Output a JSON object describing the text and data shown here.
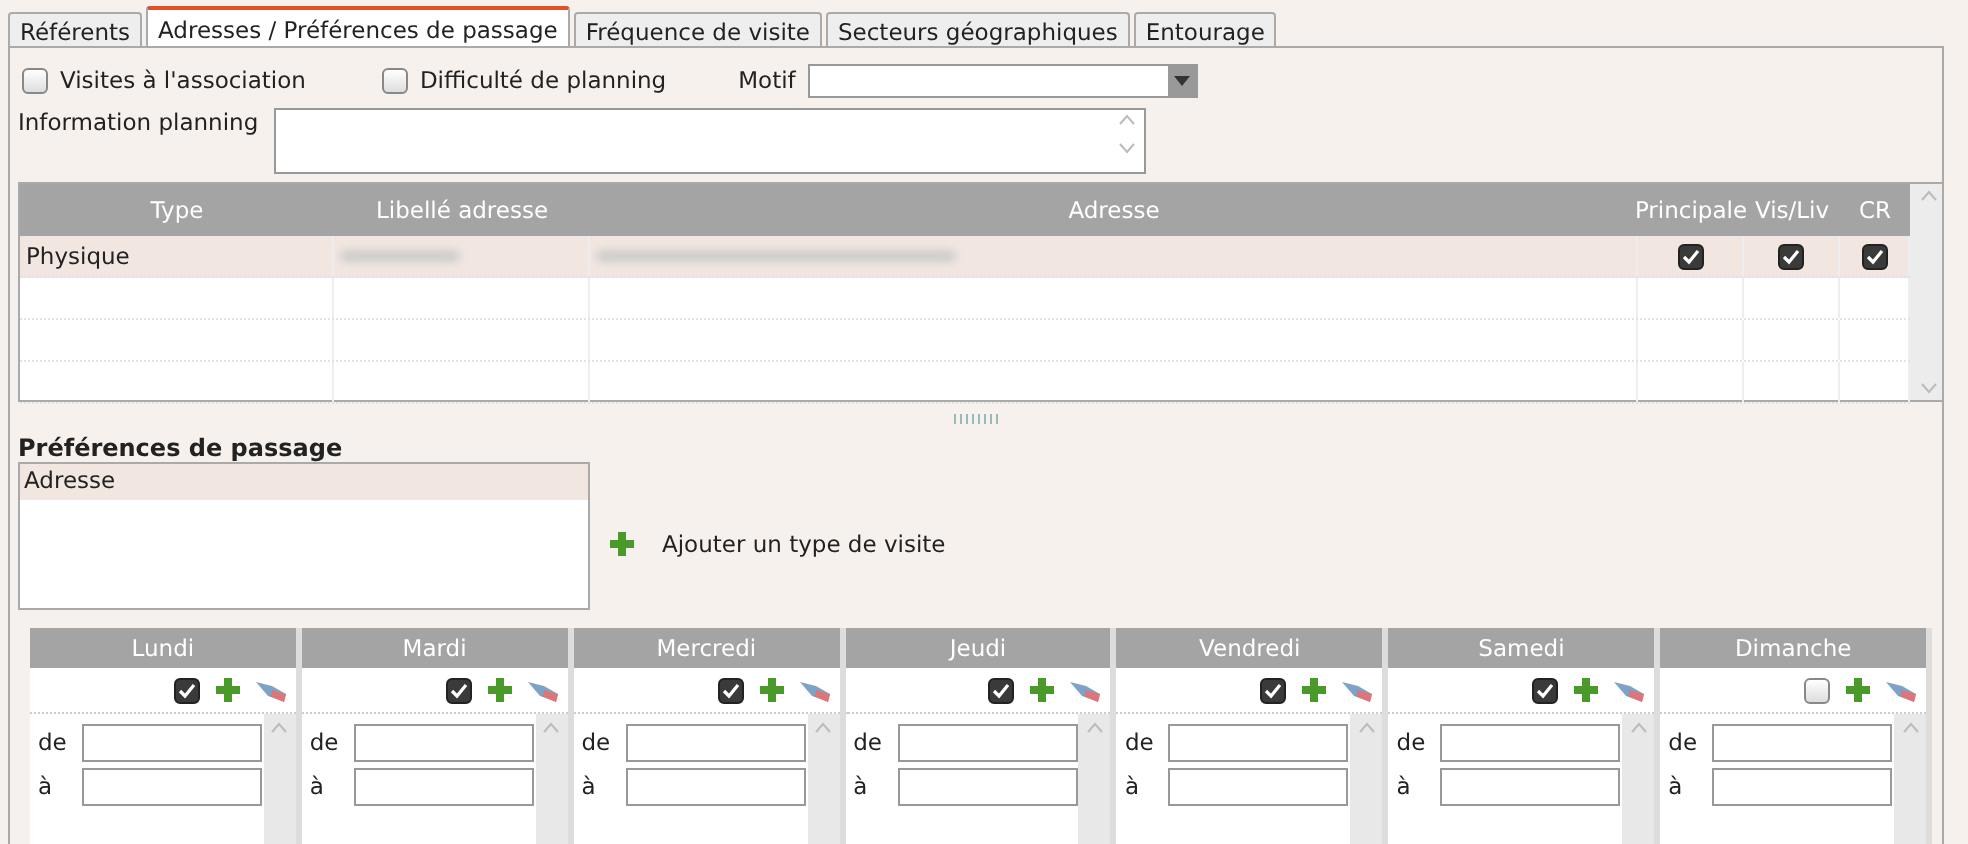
{
  "tabs": [
    {
      "label": "Référents",
      "selected": false
    },
    {
      "label": "Adresses / Préférences de passage",
      "selected": true
    },
    {
      "label": "Fréquence de visite",
      "selected": false
    },
    {
      "label": "Secteurs géographiques",
      "selected": false
    },
    {
      "label": "Entourage",
      "selected": false
    }
  ],
  "options": [
    {
      "label": "Visites à l'association",
      "checked": false
    },
    {
      "label": "Difficulté de planning",
      "checked": false
    }
  ],
  "motif": {
    "label": "Motif"
  },
  "information_planning": {
    "label": "Information planning"
  },
  "addresses": {
    "columns": [
      "Type",
      "Libellé adresse",
      "Adresse",
      "Principale",
      "Vis/Liv",
      "CR"
    ],
    "rows": [
      {
        "type": "Physique",
        "libelle_redacted": true,
        "adresse_redacted": true,
        "principale": true,
        "vis_liv": true,
        "cr": true,
        "selected": true
      }
    ]
  },
  "preferences": {
    "title": "Préférences de passage",
    "items": [
      {
        "label": "Adresse",
        "selected": true
      }
    ],
    "add_label": "Ajouter un type de visite"
  },
  "days": [
    {
      "name": "Lundi",
      "checked": true,
      "from_label": "de",
      "to_label": "à"
    },
    {
      "name": "Mardi",
      "checked": true,
      "from_label": "de",
      "to_label": "à"
    },
    {
      "name": "Mercredi",
      "checked": true,
      "from_label": "de",
      "to_label": "à"
    },
    {
      "name": "Jeudi",
      "checked": true,
      "from_label": "de",
      "to_label": "à"
    },
    {
      "name": "Vendredi",
      "checked": true,
      "from_label": "de",
      "to_label": "à"
    },
    {
      "name": "Samedi",
      "checked": true,
      "from_label": "de",
      "to_label": "à"
    },
    {
      "name": "Dimanche",
      "checked": false,
      "from_label": "de",
      "to_label": "à"
    }
  ]
}
